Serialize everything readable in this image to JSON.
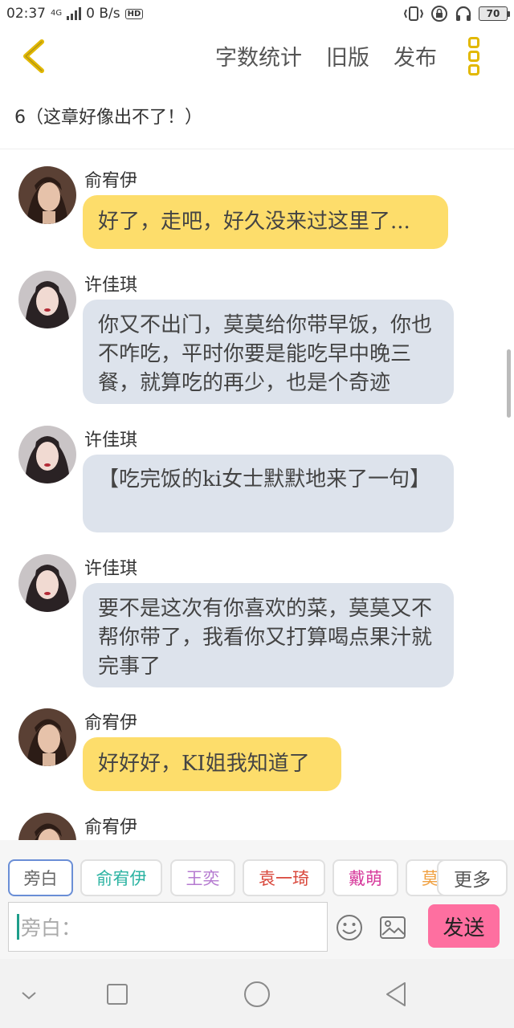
{
  "status_bar": {
    "time": "02:37",
    "network_type": "4G",
    "speed": "0 B/s",
    "hd": "HD",
    "battery": "70"
  },
  "header": {
    "actions": [
      "字数统计",
      "旧版",
      "发布"
    ]
  },
  "chapter": {
    "title": "6（这章好像出不了！）"
  },
  "messages": [
    {
      "name": "俞宥伊",
      "text": "好了，走吧，好久没来过这里了...",
      "style": "yellow"
    },
    {
      "name": "许佳琪",
      "text": "你又不出门，莫莫给你带早饭，你也不咋吃，平时你要是能吃早中晚三餐，就算吃的再少，也是个奇迹",
      "style": "gray"
    },
    {
      "name": "许佳琪",
      "text": "【吃完饭的ki女士默默地来了一句】",
      "style": "gray"
    },
    {
      "name": "许佳琪",
      "text": "要不是这次有你喜欢的菜，莫莫又不帮你带了，我看你又打算喝点果汁就完事了",
      "style": "gray"
    },
    {
      "name": "俞宥伊",
      "text": "好好好，KI姐我知道了",
      "style": "yellow"
    },
    {
      "name": "俞宥伊",
      "text": "",
      "style": "yellow"
    }
  ],
  "roles": [
    {
      "label": "旁白",
      "color": "#666666"
    },
    {
      "label": "俞宥伊",
      "color": "#2bb3a2"
    },
    {
      "label": "王奕",
      "color": "#b57ad0"
    },
    {
      "label": "袁一琦",
      "color": "#d9463a"
    },
    {
      "label": "戴萌",
      "color": "#d6399b"
    },
    {
      "label": "莫",
      "color": "#f0a040"
    }
  ],
  "more_roles_label": "更多",
  "input": {
    "placeholder": "旁白："
  },
  "send_label": "发送",
  "colors": {
    "accent_yellow": "#e2b800",
    "bubble_yellow": "#fddd6b",
    "bubble_gray": "#dde3ec",
    "send_pink": "#fe6fa0"
  }
}
